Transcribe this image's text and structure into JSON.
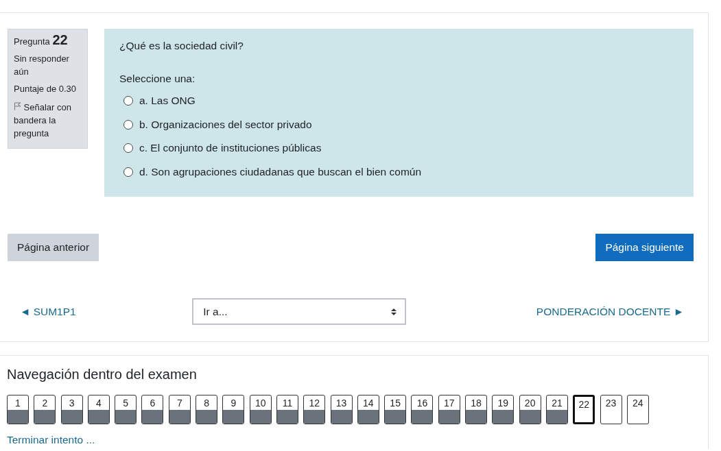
{
  "question": {
    "label": "Pregunta",
    "number": "22",
    "status": "Sin responder aún",
    "score": "Puntaje de 0.30",
    "flag": "Señalar con bandera la pregunta",
    "text": "¿Qué es la sociedad civil?",
    "prompt": "Seleccione una:",
    "options": [
      {
        "label": "a. Las ONG",
        "selected": false
      },
      {
        "label": "b. Organizaciones del sector privado",
        "selected": false
      },
      {
        "label": "c. El conjunto de instituciones públicas",
        "selected": false
      },
      {
        "label": "d. Son agrupaciones ciudadanas que buscan el bien común",
        "selected": false
      }
    ]
  },
  "buttons": {
    "previous": "Página anterior",
    "next": "Página siguiente"
  },
  "activity_nav": {
    "previous": "◄ SUM1P1",
    "jump": "Ir a...",
    "next": "PONDERACIÓN DOCENTE ►"
  },
  "quiz_navigation": {
    "title": "Navegación dentro del examen",
    "items": [
      {
        "label": "1",
        "answered": true,
        "selected": false
      },
      {
        "label": "2",
        "answered": true,
        "selected": false
      },
      {
        "label": "3",
        "answered": true,
        "selected": false
      },
      {
        "label": "4",
        "answered": true,
        "selected": false
      },
      {
        "label": "5",
        "answered": true,
        "selected": false
      },
      {
        "label": "6",
        "answered": true,
        "selected": false
      },
      {
        "label": "7",
        "answered": true,
        "selected": false
      },
      {
        "label": "8",
        "answered": true,
        "selected": false
      },
      {
        "label": "9",
        "answered": true,
        "selected": false
      },
      {
        "label": "10",
        "answered": true,
        "selected": false
      },
      {
        "label": "11",
        "answered": true,
        "selected": false
      },
      {
        "label": "12",
        "answered": true,
        "selected": false
      },
      {
        "label": "13",
        "answered": true,
        "selected": false
      },
      {
        "label": "14",
        "answered": true,
        "selected": false
      },
      {
        "label": "15",
        "answered": true,
        "selected": false
      },
      {
        "label": "16",
        "answered": true,
        "selected": false
      },
      {
        "label": "17",
        "answered": true,
        "selected": false
      },
      {
        "label": "18",
        "answered": true,
        "selected": false
      },
      {
        "label": "19",
        "answered": true,
        "selected": false
      },
      {
        "label": "20",
        "answered": true,
        "selected": false
      },
      {
        "label": "21",
        "answered": true,
        "selected": false
      },
      {
        "label": "22",
        "answered": false,
        "selected": true
      },
      {
        "label": "23",
        "answered": false,
        "selected": false
      },
      {
        "label": "24",
        "answered": false,
        "selected": false
      }
    ],
    "finish": "Terminar intento ..."
  }
}
